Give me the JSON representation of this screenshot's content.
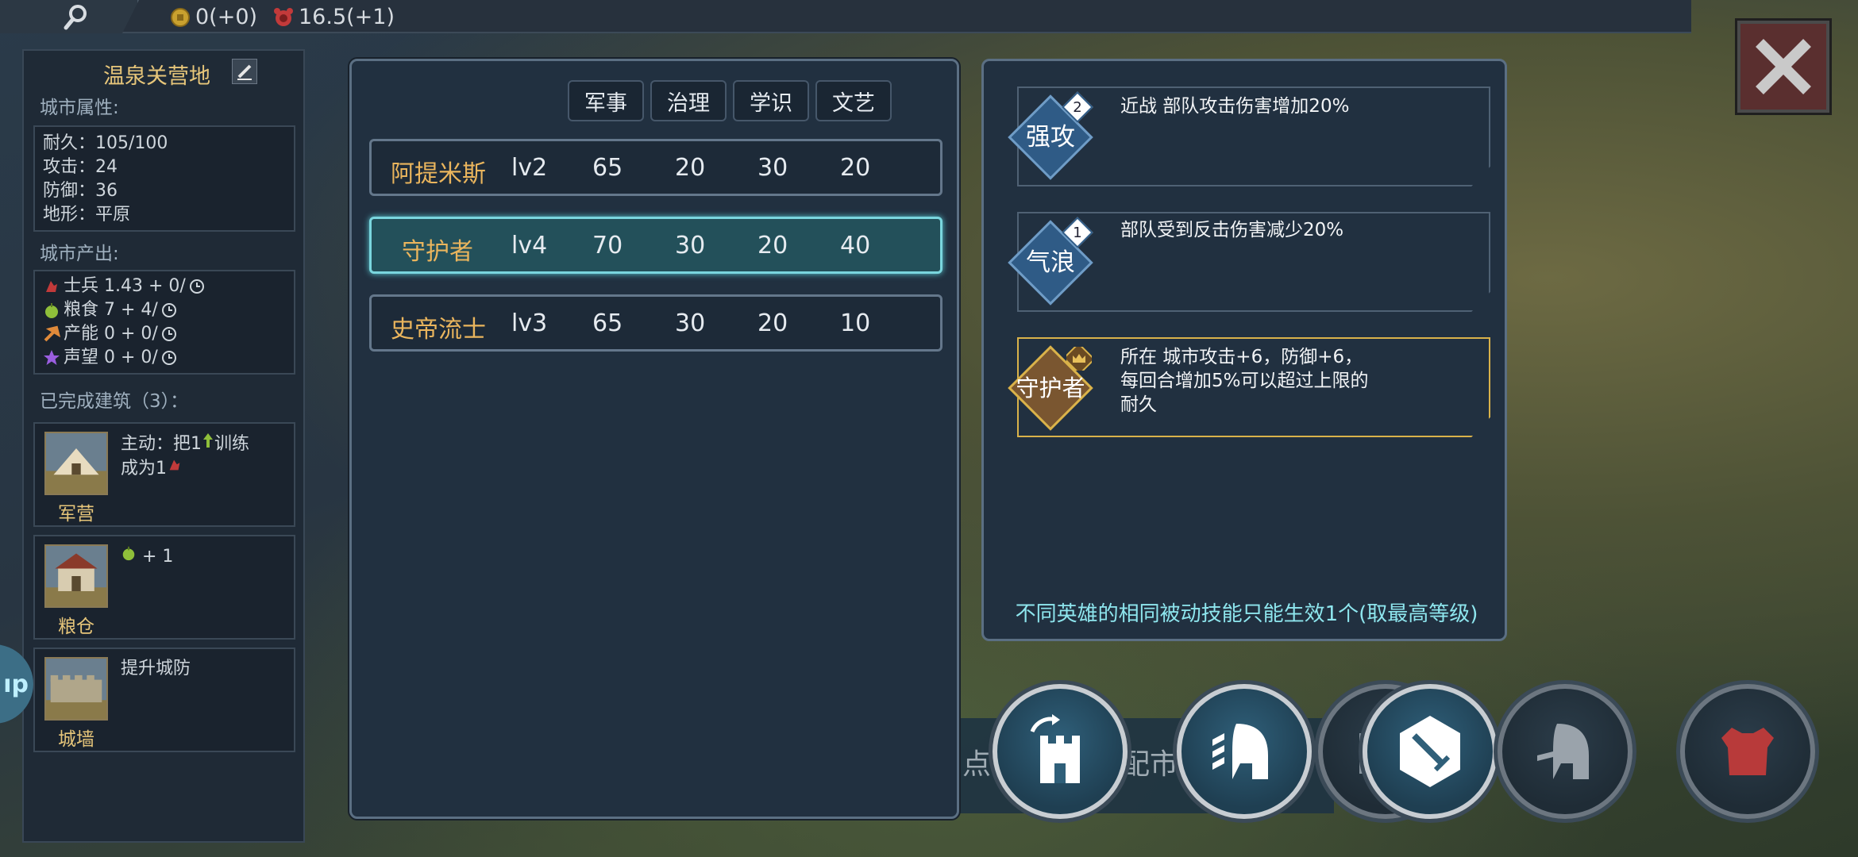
{
  "topbar": {
    "gold": "0(+0)",
    "happiness": "16.5(+1)"
  },
  "city": {
    "name": "温泉关营地",
    "attributes_label": "城市属性:",
    "attributes": [
      "耐久：105/100",
      "攻击：24",
      "防御：36",
      "地形：平原"
    ],
    "production_label": "城市产出:",
    "production": [
      {
        "icon": "soldier-icon",
        "text": "士兵 1.43 + 0/"
      },
      {
        "icon": "food-icon",
        "text": "粮食 7 + 4/"
      },
      {
        "icon": "production-icon",
        "text": "产能 0 + 0/"
      },
      {
        "icon": "prestige-icon",
        "text": "声望 0 + 0/"
      }
    ],
    "buildings_label": "已完成建筑（3）：",
    "buildings": [
      {
        "name": "军营",
        "desc_a": "主动：把1",
        "desc_b": "训练",
        "desc_c": "成为1"
      },
      {
        "name": "粮仓",
        "desc": "+ 1"
      },
      {
        "name": "城墙",
        "desc": "提升城防"
      }
    ],
    "side_tab": "ıp"
  },
  "heroes": {
    "columns": [
      "军事",
      "治理",
      "学识",
      "文艺"
    ],
    "rows": [
      {
        "name": "阿提米斯",
        "level": "lv2",
        "stats": [
          "65",
          "20",
          "30",
          "20"
        ],
        "selected": false
      },
      {
        "name": "守护者",
        "level": "lv4",
        "stats": [
          "70",
          "30",
          "20",
          "40"
        ],
        "selected": true
      },
      {
        "name": "史帝流士",
        "level": "lv3",
        "stats": [
          "65",
          "30",
          "20",
          "10"
        ],
        "selected": false
      }
    ]
  },
  "skills": {
    "items": [
      {
        "name": "强攻",
        "level": "2",
        "desc": "近战 部队攻击伤害增加20%"
      },
      {
        "name": "气浪",
        "level": "1",
        "desc": " 部队受到反击伤害减少20%"
      },
      {
        "name": "守护者",
        "desc_lines": [
          "所在 城市攻击+6，防御+6，",
          "每回合增加5%可以超过上限的",
          "耐久"
        ]
      }
    ],
    "footnote": "不同英雄的相同被动技能只能生效1个(取最高等级)"
  },
  "background_text": {
    "left": "点",
    "right": "配市"
  },
  "colors": {
    "accent_gold": "#eab55d",
    "accent_cyan": "#8ee6ee",
    "panel_bg": "#213040"
  }
}
